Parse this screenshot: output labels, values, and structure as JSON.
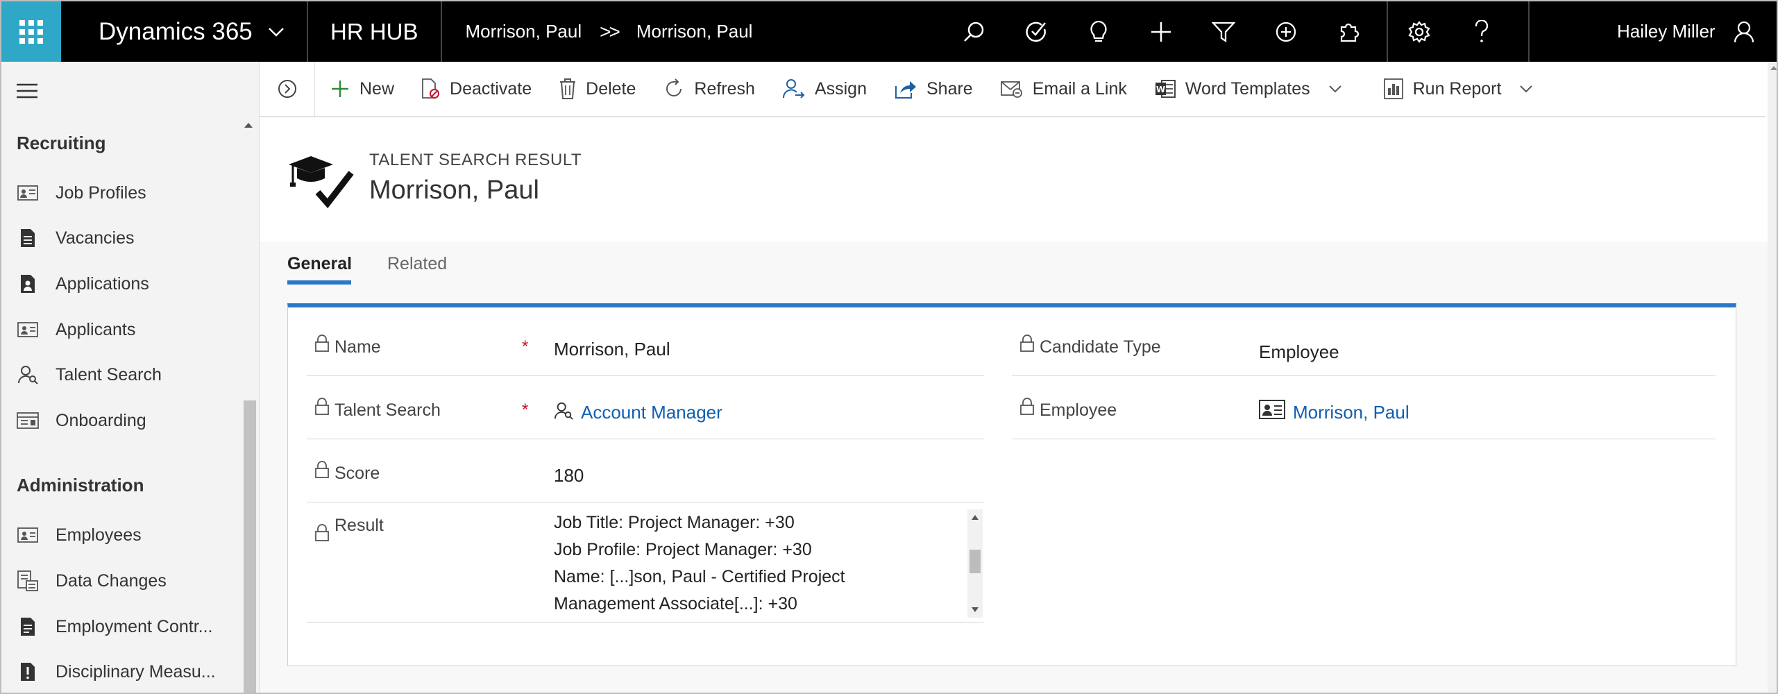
{
  "topbar": {
    "product": "Dynamics 365",
    "app": "HR HUB",
    "breadcrumb": [
      "Morrison, Paul",
      "Morrison, Paul"
    ],
    "breadcrumb_sep": ">>",
    "user": "Hailey Miller",
    "icons": [
      "search-icon",
      "task-icon",
      "lightbulb-icon",
      "plus-icon",
      "filter-icon",
      "circle-plus-icon",
      "puzzle-icon",
      "gear-icon",
      "help-icon"
    ]
  },
  "sidebar": {
    "groups": [
      {
        "title": "Recruiting",
        "items": [
          {
            "label": "Job Profiles",
            "icon": "profile-card-icon"
          },
          {
            "label": "Vacancies",
            "icon": "document-icon"
          },
          {
            "label": "Applications",
            "icon": "application-icon"
          },
          {
            "label": "Applicants",
            "icon": "contact-card-icon"
          },
          {
            "label": "Talent Search",
            "icon": "talent-search-icon"
          },
          {
            "label": "Onboarding",
            "icon": "onboarding-icon"
          }
        ]
      },
      {
        "title": "Administration",
        "items": [
          {
            "label": "Employees",
            "icon": "contact-card-icon"
          },
          {
            "label": "Data Changes",
            "icon": "data-changes-icon"
          },
          {
            "label": "Employment Contr...",
            "icon": "contract-icon"
          },
          {
            "label": "Disciplinary Measu...",
            "icon": "exclamation-doc-icon"
          }
        ]
      }
    ]
  },
  "commands": [
    {
      "label": "New",
      "icon": "plus-icon"
    },
    {
      "label": "Deactivate",
      "icon": "deactivate-icon"
    },
    {
      "label": "Delete",
      "icon": "trash-icon"
    },
    {
      "label": "Refresh",
      "icon": "refresh-icon"
    },
    {
      "label": "Assign",
      "icon": "assign-icon"
    },
    {
      "label": "Share",
      "icon": "share-icon"
    },
    {
      "label": "Email a Link",
      "icon": "email-link-icon"
    },
    {
      "label": "Word Templates",
      "icon": "word-icon",
      "dropdown": true
    },
    {
      "label": "Run Report",
      "icon": "report-icon",
      "dropdown": true
    }
  ],
  "header": {
    "entity_type": "TALENT SEARCH RESULT",
    "title": "Morrison, Paul"
  },
  "tabs": [
    {
      "label": "General",
      "active": true
    },
    {
      "label": "Related",
      "active": false
    }
  ],
  "fields": {
    "name": {
      "label": "Name",
      "required": "*",
      "value": "Morrison, Paul"
    },
    "talent_search": {
      "label": "Talent Search",
      "required": "*",
      "value": "Account Manager"
    },
    "score": {
      "label": "Score",
      "value": "180"
    },
    "result": {
      "label": "Result",
      "lines": [
        "Job Title: Project Manager: +30",
        "Job Profile: Project Manager: +30",
        "Name: [...]son, Paul - Certified Project",
        "Management Associate[...]: +30"
      ]
    },
    "candidate_type": {
      "label": "Candidate Type",
      "value": "Employee"
    },
    "employee": {
      "label": "Employee",
      "value": "Morrison, Paul"
    }
  },
  "colors": {
    "accent": "#2b78c6",
    "waffle": "#2fa8c8",
    "link": "#0f5fb0",
    "required": "#c8102e"
  }
}
